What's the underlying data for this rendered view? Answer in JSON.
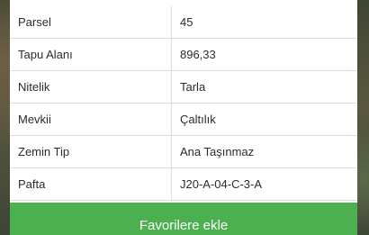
{
  "details": {
    "rows": [
      {
        "label": "Parsel",
        "value": "45"
      },
      {
        "label": "Tapu Alanı",
        "value": "896,33"
      },
      {
        "label": "Nitelik",
        "value": "Tarla"
      },
      {
        "label": "Mevkii",
        "value": "Çaltılık"
      },
      {
        "label": "Zemin Tip",
        "value": "Ana Taşınmaz"
      },
      {
        "label": "Pafta",
        "value": "J20-A-04-C-3-A"
      }
    ]
  },
  "actions": {
    "favorite_label": "Favorilere ekle"
  },
  "colors": {
    "accent": "#4caf50",
    "border": "#dcdcdc",
    "text": "#2b2b2b"
  }
}
